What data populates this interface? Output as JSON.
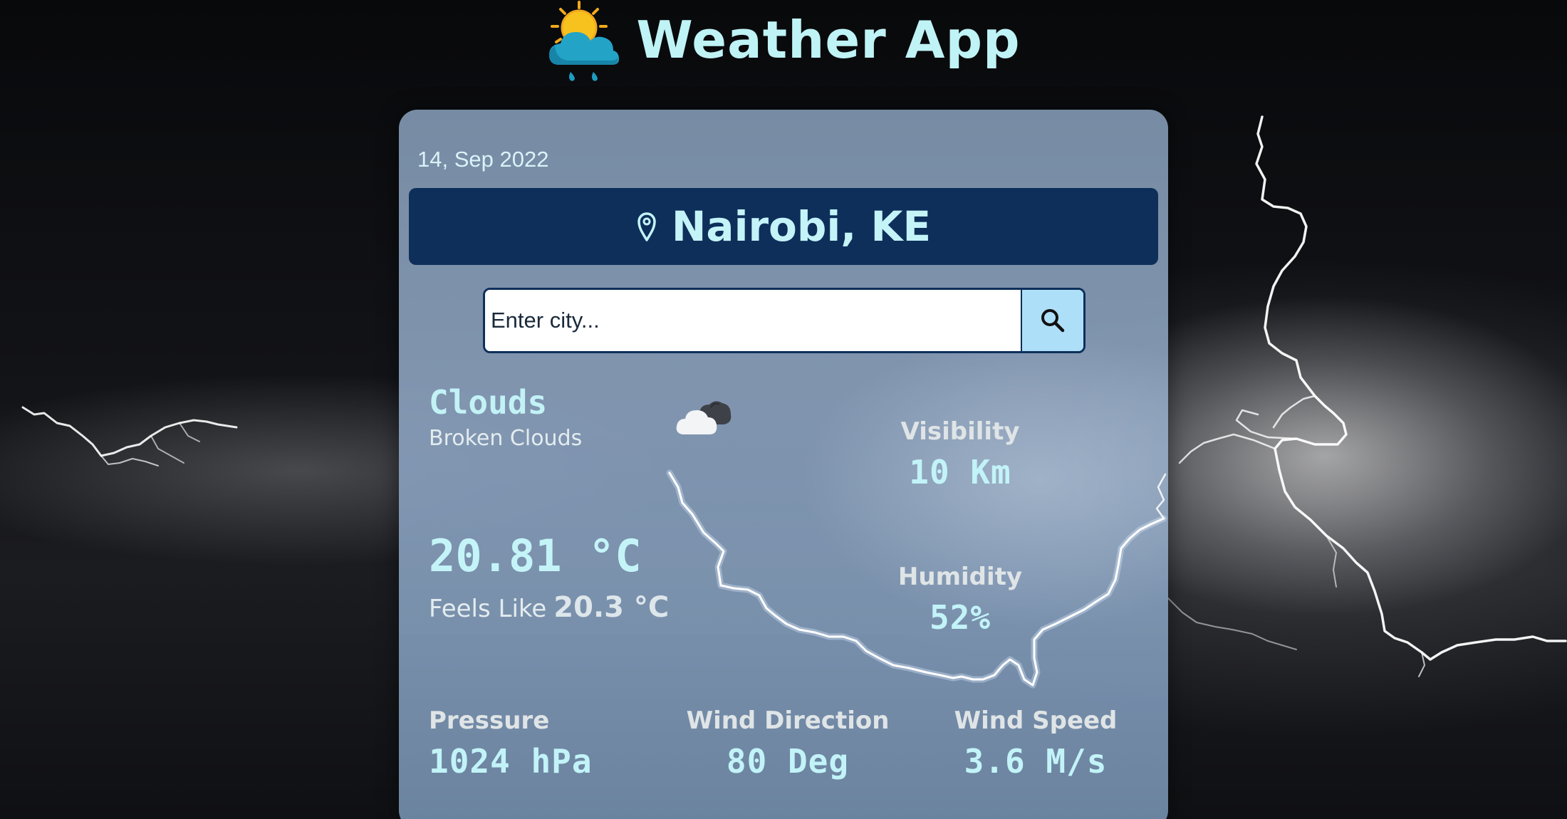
{
  "header": {
    "title": "Weather App",
    "logo_icon": "sun-cloud-rain-icon"
  },
  "card": {
    "date": "14, Sep 2022",
    "location": "Nairobi, KE",
    "search": {
      "placeholder": "Enter city...",
      "value": ""
    },
    "condition": {
      "main": "Clouds",
      "description": "Broken Clouds",
      "icon": "broken-clouds-icon"
    },
    "temperature": "20.81 °C",
    "feels_like": {
      "label": "Feels Like",
      "value": "20.3 °C"
    },
    "visibility": {
      "label": "Visibility",
      "value": "10 Km"
    },
    "humidity": {
      "label": "Humidity",
      "value": "52%"
    },
    "pressure": {
      "label": "Pressure",
      "value": "1024 hPa"
    },
    "wind_direction": {
      "label": "Wind Direction",
      "value": "80 Deg"
    },
    "wind_speed": {
      "label": "Wind Speed",
      "value": "3.6 M/s"
    }
  },
  "colors": {
    "accent_text": "#c4f3f8",
    "location_bar": "#0e2f5a",
    "search_button": "#aedff8"
  }
}
